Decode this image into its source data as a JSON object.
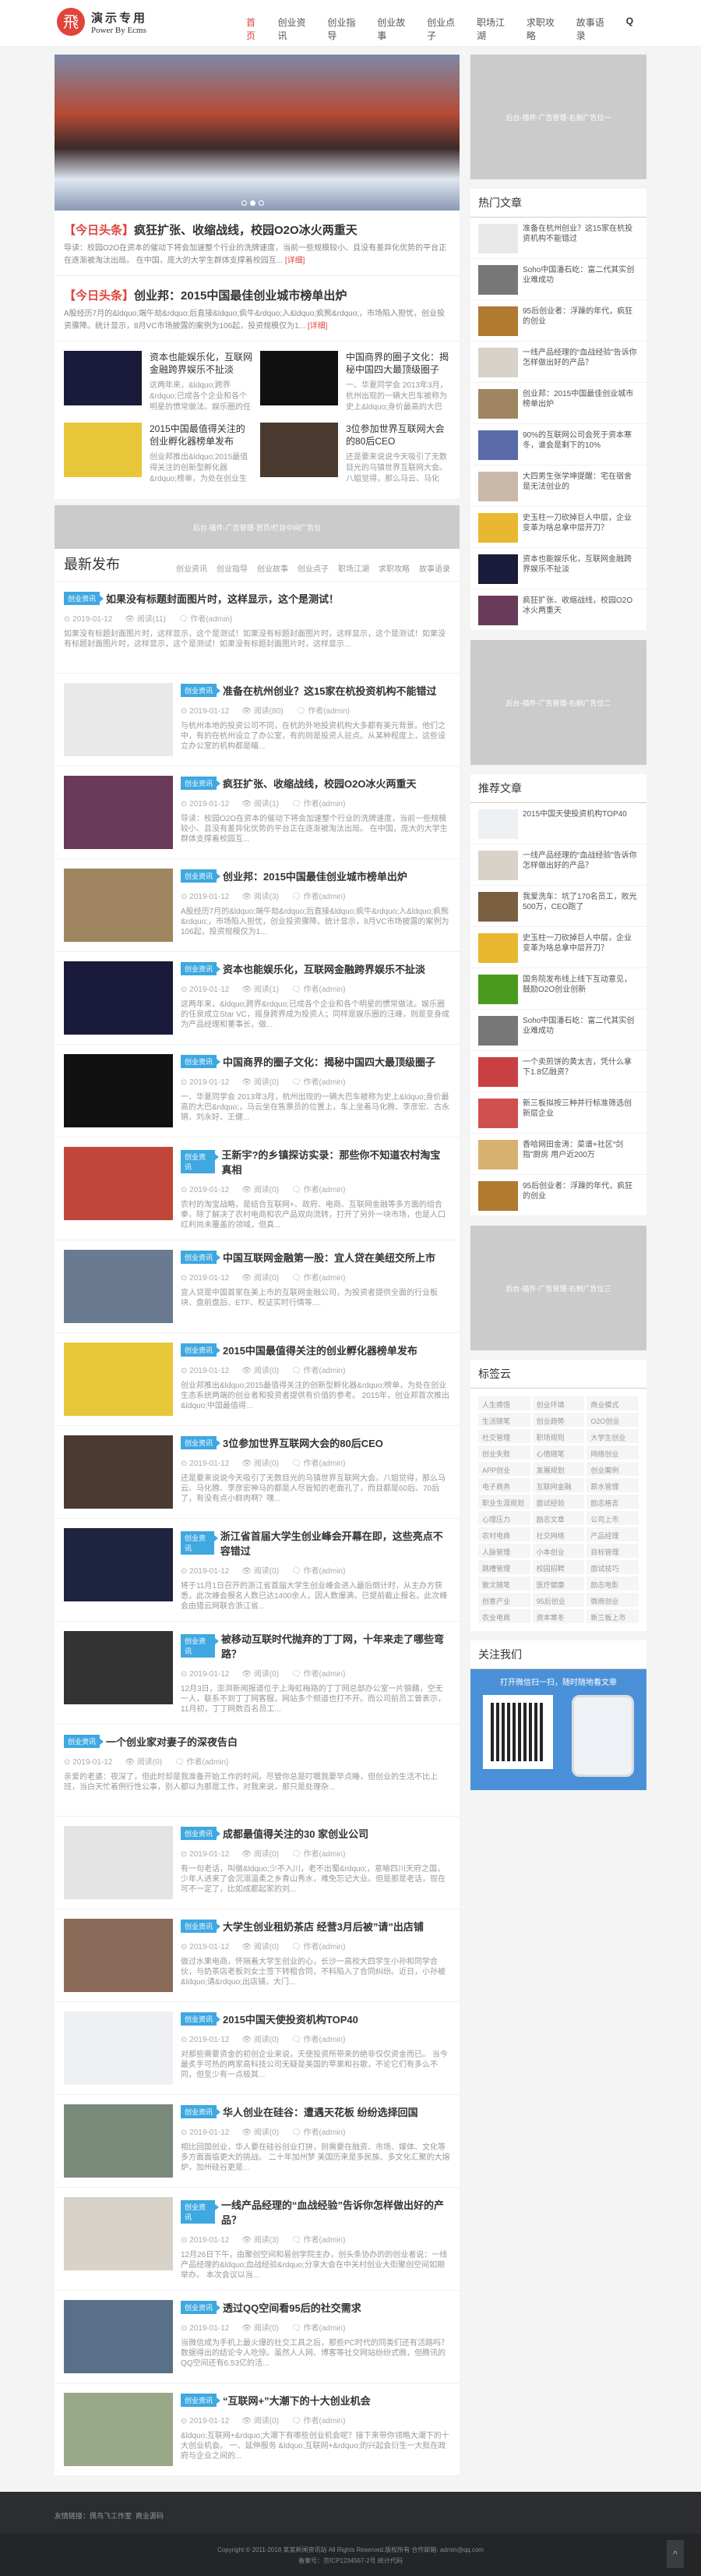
{
  "header": {
    "logo_mark": "飛",
    "logo_title": "演示专用",
    "logo_sub": "Power By Ecms",
    "nav": [
      "首页",
      "创业资讯",
      "创业指导",
      "创业故事",
      "创业点子",
      "职场江湖",
      "求职攻略",
      "故事语录"
    ],
    "dropdown_icon": "chevron-down-icon",
    "search_icon": "Q"
  },
  "headlines": [
    {
      "tag": "【今日头条】",
      "title": "疯狂扩张、收缩战线，校园O2O冰火两重天",
      "desc": "导读：校园O2O在资本的催动下将会加速整个行业的洗牌速度，当前一些规模较小、且没有差异化优势的平台正在逐渐被淘汰出局。 在中国，庞大的大学生群体支撑着校园互...",
      "more": "[详细]"
    },
    {
      "tag": "【今日头条】",
      "title": "创业邦：2015中国最佳创业城市榜单出炉",
      "desc": "A股经历7月的&ldquo;端午劫&rdquo;后直接&ldquo;疯牛&rdquo;入&ldquo;疯熊&rdquo;，市场陷入担忧，创业投资骤降。统计显示，8月VC市场披露的案例为106起，投资规模仅为1...",
      "more": "[详细]"
    }
  ],
  "grid": [
    {
      "title": "资本也能娱乐化，互联网金融跨界娱乐不扯淡",
      "desc": "这两年来，&ldquo;跨界&rdquo;已成各个企业和各个明星的惯常做法。娱乐圈的任泉成立Star VC，摇身跨界成",
      "color": "#1a1a3a"
    },
    {
      "title": "中国商界的圈子文化：揭秘中国四大最顶级圈子",
      "desc": "一、华夏同学会 2013年3月，杭州出现的一辆大巴车被称为史上&ldquo;身价最高的大巴&rdquo;，马云坐在售",
      "color": "#111"
    },
    {
      "title": "2015中国最值得关注的创业孵化器榜单发布",
      "desc": "创业邦推出&ldquo;2015最值得关注的创新型孵化器&rdquo;榜单，为处在创业生态系统两端的创业者和投资",
      "color": "#e8c63a"
    },
    {
      "title": "3位参加世界互联网大会的80后CEO",
      "desc": "还是要来说说今天吸引了无数目光的乌镇世界互联网大会。八姐觉得，那么马云、马化腾、李彦宏神马的都是",
      "color": "#4a3a30"
    }
  ],
  "ad_main": "后台-插件-广告管理-首页/栏目中间广告位",
  "latest": {
    "title": "最新发布",
    "tabs": [
      "创业资讯",
      "创业指导",
      "创业故事",
      "创业点子",
      "职场江湖",
      "求职攻略",
      "故事语录"
    ],
    "category": "创业资讯",
    "author_label": "作者(admin)",
    "date": "2019-01-12",
    "items": [
      {
        "title": "如果没有标题封面图片时，这样显示，这个是测试！",
        "views": "阅读(11)",
        "img": false,
        "desc": "如果没有标题封面图片时，这样显示，这个是测试！如果没有标题封面图片时，这样显示，这个是测试！如果没有标题封面图片时，这样显示，这个是测试！如果没有标题封面图片时，这样显示..."
      },
      {
        "title": "准备在杭州创业？这15家在杭投资机构不能错过",
        "views": "阅读(80)",
        "img": true,
        "color": "#e9e9e9",
        "desc": "与杭州本地的投资公司不同，在杭的外地投资机构大多都有美元背景。他们之中，有的在杭州设立了办公室，有的则是投资人驻点。从某种程度上，这些设立办公室的机构都是瞄..."
      },
      {
        "title": "疯狂扩张、收缩战线，校园O2O冰火两重天",
        "views": "阅读(1)",
        "img": true,
        "color": "#6a3a5a",
        "desc": "导读：校园O2O在资本的催动下将会加速整个行业的洗牌速度，当前一些规模较小、且没有差异化优势的平台正在逐渐被淘汰出局。 在中国，庞大的大学生群体支撑着校园互..."
      },
      {
        "title": "创业邦：2015中国最佳创业城市榜单出炉",
        "views": "阅读(3)",
        "img": true,
        "color": "#a08660",
        "desc": "A股经历7月的&ldquo;端午劫&rdquo;后直接&ldquo;疯牛&rdquo;入&ldquo;疯熊&rdquo;，市场陷入担忧，创业投资骤降。统计显示，8月VC市场披露的案例为106起，投资规模仅为1..."
      },
      {
        "title": "资本也能娱乐化，互联网金融跨界娱乐不扯淡",
        "views": "阅读(1)",
        "img": true,
        "color": "#1a1a3a",
        "desc": "这两年来，&ldquo;跨界&rdquo;已成各个企业和各个明星的惯常做法。娱乐圈的任泉成立Star VC，摇身跨界成为投资人；同样是娱乐圈的汪峰，则是变身成为产品经理和董事长，做..."
      },
      {
        "title": "中国商界的圈子文化：揭秘中国四大最顶级圈子",
        "views": "阅读(0)",
        "img": true,
        "color": "#111",
        "desc": "一、华夏同学会 2013年3月，杭州出现的一辆大巴车被称为史上&ldquo;身价最高的大巴&rdquo;，马云坐在售票员的位置上，车上坐着马化腾、李彦宏、古永锵、刘永好、王健..."
      },
      {
        "title": "王新宇?的乡镇探访实录：那些你不知道农村淘宝真相",
        "views": "阅读(0)",
        "img": true,
        "color": "#c0463a",
        "desc": "农村的淘宝战略，是结合互联网+、政府、电商、互联网金融等多方面的组合拳，除了解决了农村电商和农产品双向流转，打开了另外一块市场，也是人口红利尚未覆盖的领域，但真..."
      },
      {
        "title": "中国互联网金融第一股：宜人贷在美纽交所上市",
        "views": "阅读(0)",
        "img": true,
        "color": "#6a7a90",
        "desc": "宜人贷是中国首家在美上市的互联网金融公司，为投资者提供全面的行业板块、盘前盘后、ETF、权证实时行情等...."
      },
      {
        "title": "2015中国最值得关注的创业孵化器榜单发布",
        "views": "阅读(0)",
        "img": true,
        "color": "#e8c63a",
        "desc": "创业邦推出&ldquo;2015最值得关注的创新型孵化器&rdquo;榜单，为处在创业生态系统两端的创业者和投资者提供有价值的参考。 2015年，创业邦首次推出&ldquo;中国最值得..."
      },
      {
        "title": "3位参加世界互联网大会的80后CEO",
        "views": "阅读(0)",
        "img": true,
        "color": "#4a3a30",
        "desc": "还是要来说说今天吸引了无数目光的乌镇世界互联网大会。八姐觉得，那么马云、马化腾、李彦宏神马的都是人尽皆知的老面孔了，而且都是60后、70后了，有没有点小鲜肉啊？嘿..."
      },
      {
        "title": "浙江省首届大学生创业峰会开幕在即，这些亮点不容错过",
        "views": "阅读(0)",
        "img": true,
        "color": "#1f2440",
        "desc": "将于11月1日召开的浙江省首届大学生创业峰会进入最后倒计时，从主办方获悉，此次峰会报名人数已达1400余人，因人数爆满，已提前截止报名。此次峰会由猎云网联合浙江省..."
      },
      {
        "title": "被移动互联时代抛弃的丁丁网，十年来走了哪些弯路？",
        "views": "阅读(0)",
        "img": true,
        "color": "#333",
        "desc": "12月3日，澎湃新闻报道位于上海虹梅路的丁丁网总部办公室一片狼藉，空无一人，联系不到丁丁网客服，网站多个频道也打不开。而公司前员工曾表示，11月初，丁丁网数百名员工..."
      },
      {
        "title": "一个创业家对妻子的深夜告白",
        "views": "阅读(0)",
        "img": false,
        "desc": "亲爱的老婆：夜深了，但此时却是我准备开始工作的时间。尽管你总是叮嘱我要早点睡，但创业的生活不比上班，当白天忙着例行性公事，别人都以为那是工作，对我来说，那只是处理杂..."
      },
      {
        "title": "成都最值得关注的30 家创业公司",
        "views": "阅读(0)",
        "img": true,
        "color": "#e4e4e4",
        "desc": "有一句老话，叫做&ldquo;少不入川，老不出蜀&rdquo;，意喻四川天府之国，少年人进来了会沉溺温柔之乡青山秀水，难免忘记大业。但是那是老话，现在可不一定了，比如成都起家的刘..."
      },
      {
        "title": "大学生创业租奶茶店 经营3月后被”请”出店铺",
        "views": "阅读(0)",
        "img": true,
        "color": "#8a6a58",
        "desc": "做过水果电商，怀揣着大学生创业的心，长沙一高校大四学生小孙和同学合伙，与奶茶店老板刘女士签下转租合同，不料陷入了合同纠纷。近日，小孙被&ldquo;请&rdquo;出店铺，大门..."
      },
      {
        "title": "2015中国天使投资机构TOP40",
        "views": "阅读(0)",
        "img": true,
        "color": "#eef0f4",
        "desc": "对那些需要资金的初创企业来说，天使投资所带来的绝非仅仅资金而已。 当今最炙手可热的两家高科技公司无疑是美国的苹果和谷歌，不论它们有多么不同，但至少有一点极其..."
      },
      {
        "title": "华人创业在硅谷：遭遇天花板 纷纷选择回国",
        "views": "阅读(0)",
        "img": true,
        "color": "#7a8a7a",
        "desc": "相比回国创业，华人要在硅谷创业打拼，则需要在融资、市场、媒体、文化等多方面面临更大的挑战。 二十年加州梦 美国历来是多民族、多文化汇聚的大熔炉，加州硅谷更是..."
      },
      {
        "title": "一线产品经理的“血战经验”告诉你怎样做出好的产品？",
        "views": "阅读(3)",
        "img": true,
        "color": "#d8d2c8",
        "desc": "12月26日下午，由聚创空间和易创学院主办，创头条协办的的创业者说：一线产品经理的&ldquo;血战经验&rdquo;分享大会在中关村创业大街聚创空间如期举办。 本次会议以当..."
      },
      {
        "title": "透过QQ空间看95后的社交需求",
        "views": "阅读(0)",
        "img": true,
        "color": "#5a7088",
        "desc": "当微信成为手机上最火爆的社交工具之后，那些PC时代的同类们还有活路吗？数据得出的结论令人吃惊。虽然人人网、博客等社交网站纷纷式微，但腾讯的QQ空间还有6.53亿的活..."
      },
      {
        "title": "“互联网+”大潮下的十大创业机会",
        "views": "阅读(0)",
        "img": true,
        "color": "#9aa88a",
        "desc": "&ldquo;互联网+&rdquo;大潮下有哪些创业机会呢？接下来带你领略大潮下的十大创业机会。 一、延伸服务 &ldquo;互联网+&rdquo;的兴起会衍生一大批在政府与企业之间的..."
      }
    ]
  },
  "sidebar": {
    "ad1": "后台-插件-广告管理-右侧广告位一",
    "ad2": "后台-插件-广告管理-右侧广告位二",
    "ad3": "后台-插件-广告管理-右侧广告位三",
    "hot_title": "热门文章",
    "hot": [
      {
        "t": "准备在杭州创业？这15家在杭投资机构不能错过",
        "c": "#e9e9e9"
      },
      {
        "t": "Soho中国潘石屹：富二代其实创业难成功",
        "c": "#777"
      },
      {
        "t": "95后创业者：浮躁的年代，疯狂的创业",
        "c": "#b07a30"
      },
      {
        "t": "一线产品经理的“血战经验”告诉你怎样做出好的产品？",
        "c": "#d8d2c8"
      },
      {
        "t": "创业邦：2015中国最佳创业城市榜单出炉",
        "c": "#a08660"
      },
      {
        "t": "90%的互联网公司会死于资本寒冬，谁会是剩下的10%",
        "c": "#5a6aa8"
      },
      {
        "t": "大四男生张学坤提醒：宅在宿舍是无法创业的",
        "c": "#c8b8a8"
      },
      {
        "t": "史玉柱一刀砍掉巨人中层，企业变革为啥总拿中层开刀？",
        "c": "#e8b830"
      },
      {
        "t": "资本也能娱乐化，互联网金融跨界娱乐不扯淡",
        "c": "#1a1a3a"
      },
      {
        "t": "疯狂扩张、收缩战线，校园O2O冰火两重天",
        "c": "#6a3a5a"
      }
    ],
    "rec_title": "推荐文章",
    "rec": [
      {
        "t": "2015中国天使投资机构TOP40",
        "c": "#eef0f4"
      },
      {
        "t": "一线产品经理的“血战经验”告诉你怎样做出好的产品？",
        "c": "#d8d2c8"
      },
      {
        "t": "我爱洗车：坑了170名员工，败光500万，CEO跑了",
        "c": "#7a6040"
      },
      {
        "t": "史玉柱一刀砍掉巨人中层，企业变革为啥总拿中层开刀？",
        "c": "#e8b830"
      },
      {
        "t": "国务院发布线上线下互动意见，鼓励O2O创业创新",
        "c": "#4a9a20"
      },
      {
        "t": "Soho中国潘石屹：富二代其实创业难成功",
        "c": "#777"
      },
      {
        "t": "一个卖煎饼的黄太吉，凭什么拿下1.8亿融资？",
        "c": "#c84040"
      },
      {
        "t": "新三板拟按三种并行标准筛选创新层企业",
        "c": "#d05050"
      },
      {
        "t": "香哈网田金涛：菜谱+社区“剑指”厨房 用户近200万",
        "c": "#d8b070"
      },
      {
        "t": "95后创业者：浮躁的年代，疯狂的创业",
        "c": "#b07a30"
      }
    ],
    "tags_title": "标签云",
    "tags": [
      "人生感悟",
      "创业环境",
      "商业模式",
      "生活随笔",
      "创业趋势",
      "O2O创业",
      "社交管理",
      "职场规则",
      "大学生创业",
      "创业失败",
      "心情随笔",
      "网络创业",
      "APP创业",
      "发展规划",
      "创业案例",
      "电子商务",
      "互联网金融",
      "薪水管理",
      "职业生涯规划",
      "面试经验",
      "励志格言",
      "心理压力",
      "励志文章",
      "公司上市",
      "农村电商",
      "社交网络",
      "产品经理",
      "人脉管理",
      "小本创业",
      "目标管理",
      "跳槽管理",
      "校园招聘",
      "面试技巧",
      "散文随笔",
      "医疗健康",
      "励志电影",
      "创意产业",
      "95后创业",
      "微商创业",
      "农业电商",
      "资本寒冬",
      "新三板上市"
    ],
    "follow_title": "关注我们",
    "follow_text": "打开微信扫一扫，随时随地看文章"
  },
  "footer": {
    "links_label": "友情链接：",
    "links": [
      "佩鸟飞工作室",
      "商业源码"
    ],
    "copyright": "Copyright © 2011-2018 某某新闻资讯站 All Rights Reserved.版权所有 合作邮箱: admin@qq.com",
    "icp": "备案号：京ICP1234567-2号 统计代码",
    "top": "^"
  }
}
